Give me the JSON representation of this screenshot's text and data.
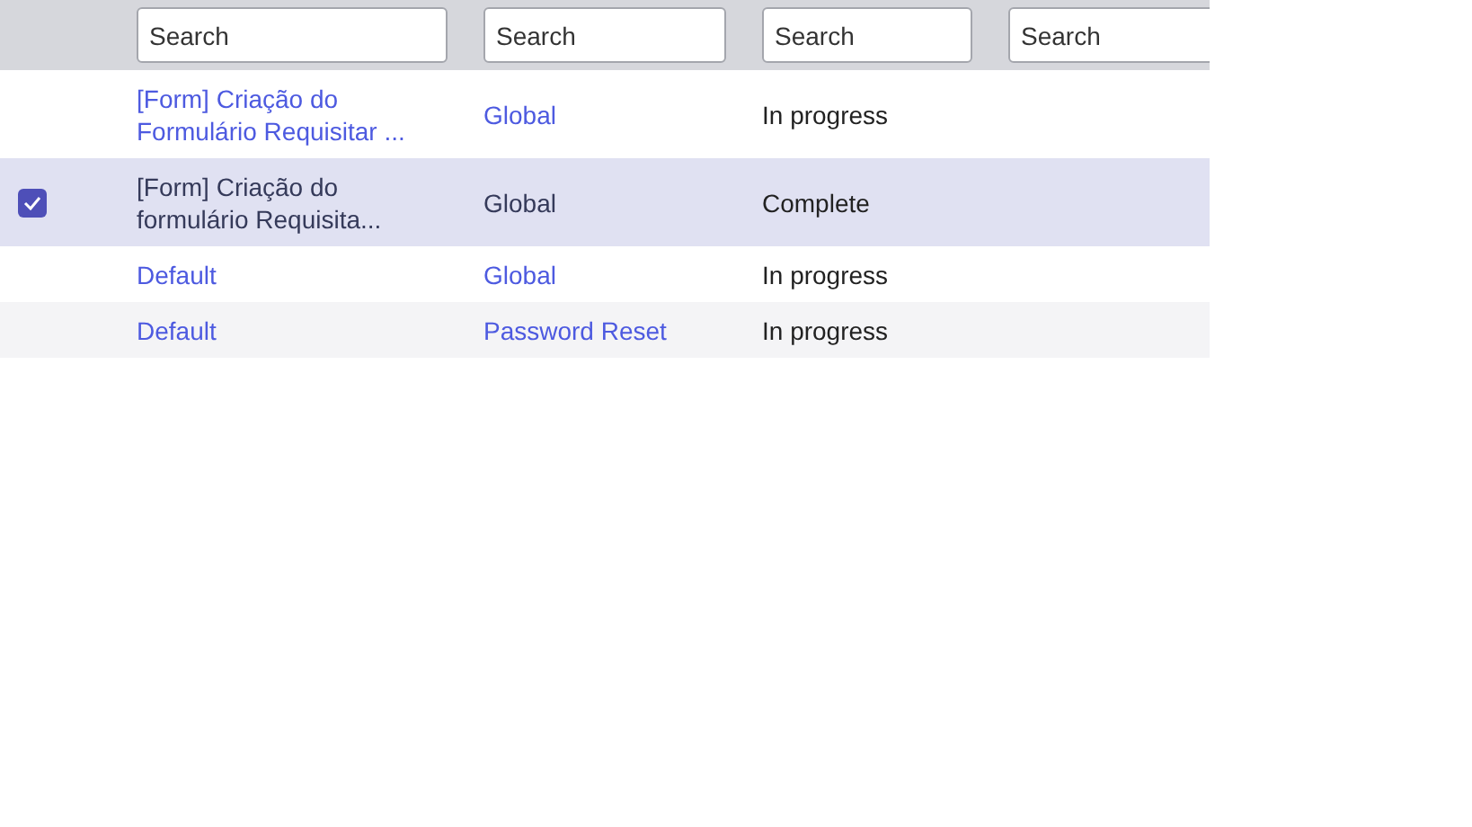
{
  "filters": [
    {
      "placeholder": "Search"
    },
    {
      "placeholder": "Search"
    },
    {
      "placeholder": "Search"
    },
    {
      "placeholder": "Search"
    }
  ],
  "rows": [
    {
      "selected": false,
      "name": "[Form] Criação do Formulário Requisitar ...",
      "scope": "Global",
      "status": "In progress"
    },
    {
      "selected": true,
      "name": "[Form] Criação do formulário Requisita...",
      "scope": "Global",
      "status": "Complete"
    },
    {
      "selected": false,
      "name": "Default",
      "scope": "Global",
      "status": "In progress"
    },
    {
      "selected": false,
      "name": "Default",
      "scope": "Password Reset",
      "status": "In progress"
    }
  ]
}
